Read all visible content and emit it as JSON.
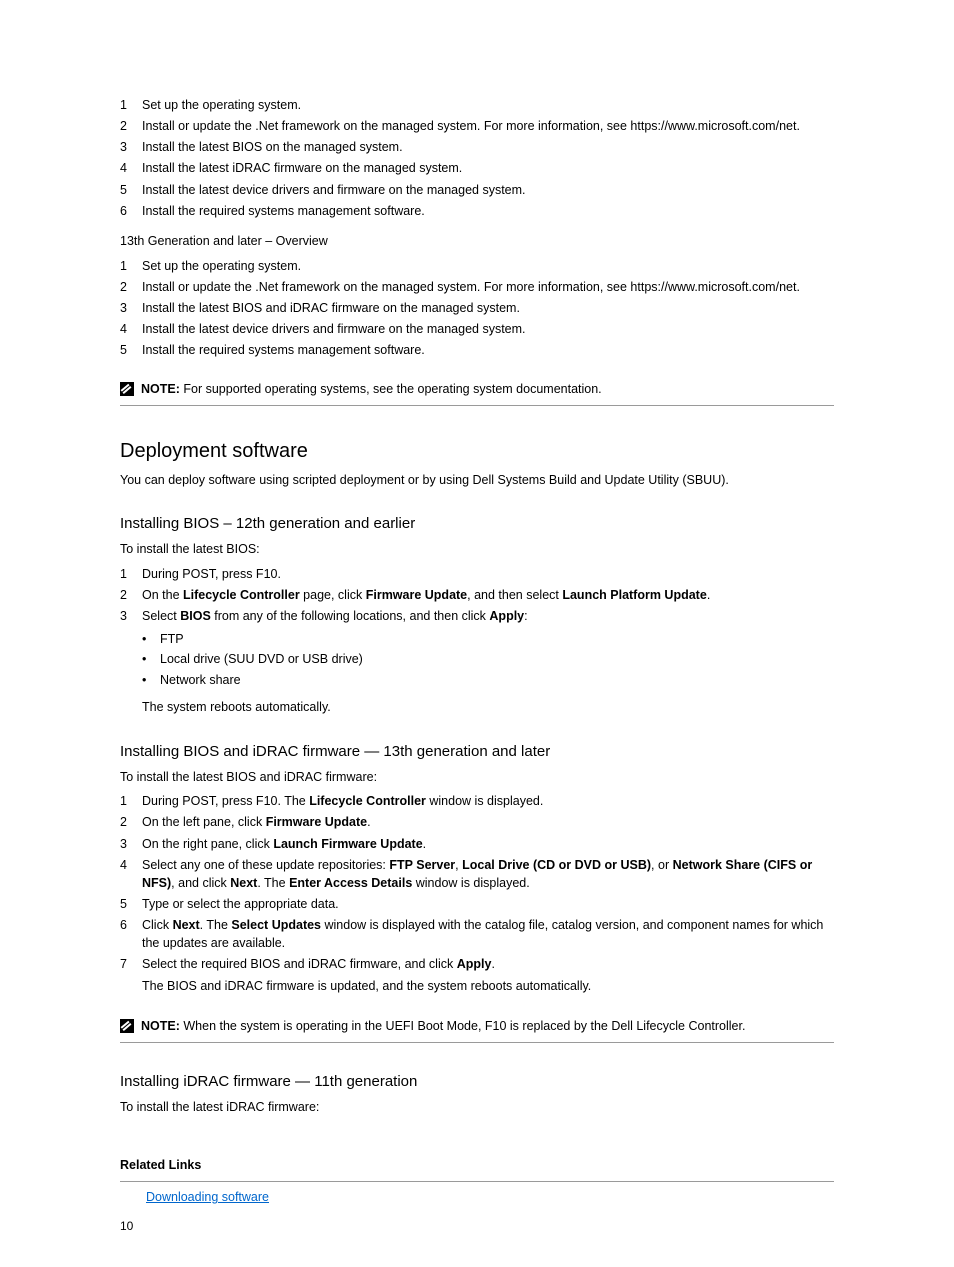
{
  "steps_a": [
    {
      "n": "1",
      "t": "Set up the operating system."
    },
    {
      "n": "2",
      "t": "Install or update the .Net framework on the managed system. For more information, see https://www.microsoft.com/net."
    },
    {
      "n": "3",
      "t": "Install the latest BIOS on the managed system."
    },
    {
      "n": "4",
      "t": "Install the latest iDRAC firmware on the managed system."
    },
    {
      "n": "5",
      "t": "Install the latest device drivers and firmware on the managed system."
    },
    {
      "n": "6",
      "t": "Install the required systems management software."
    }
  ],
  "steps_b": [
    {
      "n": "1",
      "t": "Set up the operating system."
    },
    {
      "n": "2",
      "t": "Install or update the .Net framework on the managed system. For more information, see https://www.microsoft.com/net."
    },
    {
      "n": "3",
      "t": "Install the latest BIOS and iDRAC firmware on the managed system."
    },
    {
      "n": "4",
      "t": "Install the latest device drivers and firmware on the managed system."
    },
    {
      "n": "5",
      "t": "Install the required systems management software."
    }
  ],
  "note1": {
    "lead": "NOTE:",
    "body": " For supported operating systems, see the operating system documentation."
  },
  "note2": {
    "lead": "NOTE:",
    "body": " When the system is operating in the UEFI Boot Mode, F10 is replaced by the Dell Lifecycle Controller."
  },
  "sec_deploy_title": "Deployment software",
  "sec_deploy_body": "You can deploy software using scripted deployment or by using Dell Systems Build and Update Utility (SBUU).",
  "bios_title": "Installing BIOS – 12th generation and earlier",
  "bios_intro": "To install the latest BIOS:",
  "bios_steps": [
    {
      "n": "1",
      "t": "During POST, press F10."
    },
    {
      "n": "2",
      "t": "On the Lifecycle Controller page, click Firmware Update, and then select Launch Platform Update."
    },
    {
      "n": "3",
      "t": "Select BIOS from any of the following locations, and then click Apply:"
    }
  ],
  "bios_bullets": [
    "FTP",
    "Local drive (SUU DVD or USB drive)",
    "Network share"
  ],
  "bios_reboot": "The system reboots automatically.",
  "g13_title": "Installing BIOS and iDRAC firmware — 13th generation and later",
  "g13_intro": "To install the latest BIOS and iDRAC firmware:",
  "g13_steps": [
    {
      "n": "1",
      "t": "During POST, press F10. The Lifecycle Controller window is displayed."
    },
    {
      "n": "2",
      "t": "On the left pane, click Firmware Update."
    },
    {
      "n": "3",
      "t": "On the right pane, click Launch Firmware Update."
    },
    {
      "n": "4",
      "t": "Select any one of these update repositories: FTP Server, Local Drive (CD or DVD or USB), or Network Share (CIFS or NFS), and click Next. The Enter Access Details window is displayed."
    },
    {
      "n": "5",
      "t": "Type or select the appropriate data."
    },
    {
      "n": "6",
      "t": "Click Next. The Select Updates window is displayed with the catalog file, catalog version, and component names for which the updates are available."
    },
    {
      "n": "7",
      "t": "Select the required BIOS and iDRAC firmware, and click Apply."
    }
  ],
  "g13_after": "The BIOS and iDRAC firmware is updated, and the system reboots automatically.",
  "related_title": "Related Links",
  "related_link": "Downloading software",
  "idrac11_title": "Installing iDRAC firmware — 11th generation",
  "idrac11_intro": "To install the latest iDRAC firmware:",
  "footer": "10"
}
